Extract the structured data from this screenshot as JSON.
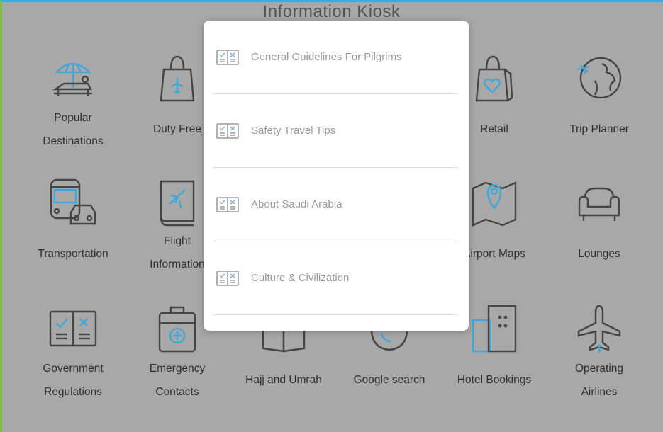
{
  "header": {
    "title": "Information Kiosk"
  },
  "tiles": [
    {
      "label_lines": [
        "Popular",
        "Destinations"
      ],
      "icon": "beach-umbrella-icon"
    },
    {
      "label_lines": [
        "Duty Free"
      ],
      "icon": "shopping-bag-plane-icon"
    },
    {
      "label_lines": [
        "Retail"
      ],
      "icon": "shopping-bag-heart-icon"
    },
    {
      "label_lines": [
        "Trip Planner"
      ],
      "icon": "globe-plane-icon"
    },
    {
      "label_lines": [
        "Transportation"
      ],
      "icon": "bus-car-icon"
    },
    {
      "label_lines": [
        "Flight",
        "Information"
      ],
      "icon": "flight-book-icon"
    },
    {
      "label_lines": [
        "Airport Maps"
      ],
      "icon": "map-pin-icon"
    },
    {
      "label_lines": [
        "Lounges"
      ],
      "icon": "sofa-icon"
    },
    {
      "label_lines": [
        "Government",
        "Regulations"
      ],
      "icon": "checklist-book-icon"
    },
    {
      "label_lines": [
        "Emergency",
        "Contacts"
      ],
      "icon": "first-aid-kit-icon"
    },
    {
      "label_lines": [
        "Hajj and Umrah"
      ],
      "icon": "book-icon"
    },
    {
      "label_lines": [
        "Google search"
      ],
      "icon": "search-icon"
    },
    {
      "label_lines": [
        "Hotel Bookings"
      ],
      "icon": "hotel-building-icon"
    },
    {
      "label_lines": [
        "Operating",
        "Airlines"
      ],
      "icon": "airplane-icon"
    }
  ],
  "modal": {
    "items": [
      {
        "label": "General Guidelines For Pilgrims",
        "icon": "checklist-book-icon"
      },
      {
        "label": "Safety Travel Tips",
        "icon": "checklist-book-icon"
      },
      {
        "label": "About Saudi Arabia",
        "icon": "checklist-book-icon"
      },
      {
        "label": "Culture & Civilization",
        "icon": "checklist-book-icon"
      }
    ]
  },
  "colors": {
    "accent": "#3fa8d8",
    "frame_left": "#7fbf3f",
    "overlay": "#a8a8a8",
    "icon_stroke": "#444444"
  }
}
